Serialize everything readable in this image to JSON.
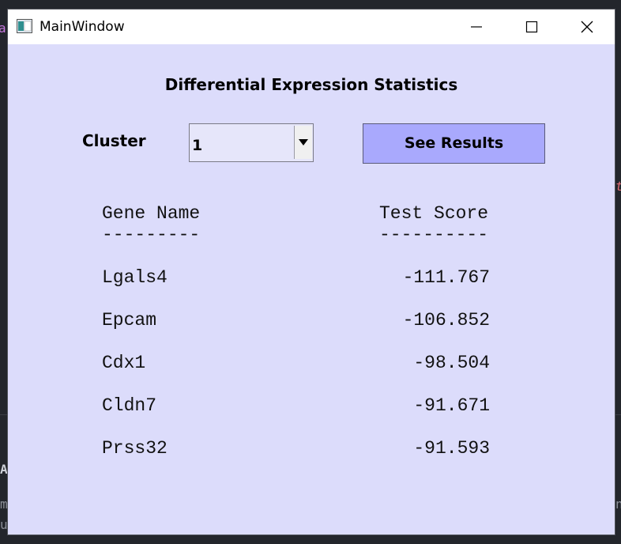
{
  "background": {
    "fragments": [
      {
        "text": "as",
        "color": "#c678dd"
      },
      {
        "text": "t",
        "color": "#e06c75"
      },
      {
        "text": "A",
        "color": "#cfd3da"
      },
      {
        "text": "m",
        "color": "#8b8f98"
      },
      {
        "text": "u",
        "color": "#8b8f98"
      },
      {
        "text": "n",
        "color": "#8b8f98"
      }
    ]
  },
  "window": {
    "title": "MainWindow",
    "controls": [
      "minimize-icon",
      "maximize-icon",
      "close-icon"
    ]
  },
  "heading": "Differential Expression Statistics",
  "cluster": {
    "label": "Cluster",
    "selected_value": "1"
  },
  "see_results_label": "See Results",
  "table": {
    "header": {
      "gene": "Gene Name",
      "score": "Test Score",
      "gene_rule": "---------",
      "score_rule": "----------"
    },
    "rows": [
      {
        "gene": "Lgals4",
        "score": "-111.767"
      },
      {
        "gene": "Epcam",
        "score": "-106.852"
      },
      {
        "gene": "Cdx1",
        "score": "-98.504"
      },
      {
        "gene": "Cldn7",
        "score": "-91.671"
      },
      {
        "gene": "Prss32",
        "score": "-91.593"
      }
    ]
  },
  "colors": {
    "window_bg": "#dcdcfb",
    "button_bg": "#a9a9fd",
    "titlebar_bg": "#ffffff",
    "desktop_bg": "#23262c"
  }
}
